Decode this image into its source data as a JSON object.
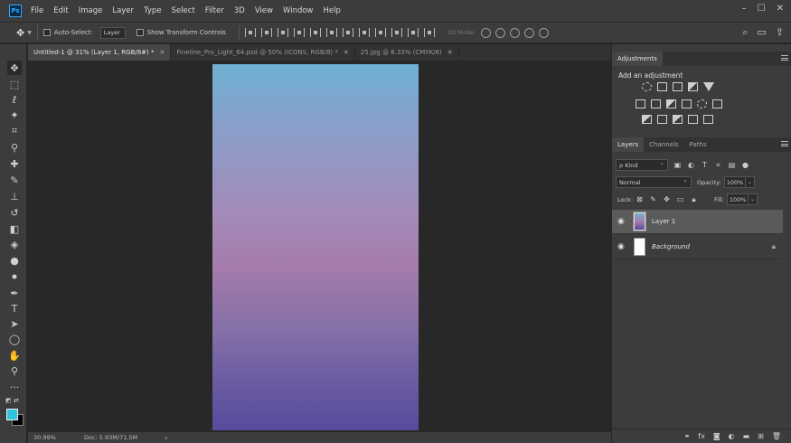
{
  "app": {
    "logo_text": "Ps"
  },
  "menu": [
    "File",
    "Edit",
    "Image",
    "Layer",
    "Type",
    "Select",
    "Filter",
    "3D",
    "View",
    "Window",
    "Help"
  ],
  "options_bar": {
    "auto_select_label": "Auto-Select:",
    "auto_select_value": "Layer",
    "show_transform_label": "Show Transform Controls",
    "three_d_mode_label": "3D Mode:"
  },
  "doc_tabs": [
    {
      "label": "Untitled-1 @ 31% (Layer 1, RGB/8#) *",
      "active": true
    },
    {
      "label": "Fineline_Pro_Light_64.psd @ 50% (ICONS, RGB/8) *",
      "active": false
    },
    {
      "label": "25.jpg @ 8.33% (CMYK/8)",
      "active": false
    }
  ],
  "status": {
    "zoom": "30.99%",
    "doc": "Doc: 5.93M/71.5M",
    "arrow": "›"
  },
  "adjustments": {
    "tab": "Adjustments",
    "title": "Add an adjustment"
  },
  "layers_panel": {
    "tabs": [
      "Layers",
      "Channels",
      "Paths"
    ],
    "kind_label": "ρ Kind",
    "blend_mode": "Normal",
    "opacity_label": "Opacity:",
    "opacity_value": "100%",
    "lock_label": "Lock:",
    "fill_label": "Fill:",
    "fill_value": "100%",
    "layers": [
      {
        "name": "Layer 1",
        "selected": true
      },
      {
        "name": "Background",
        "selected": false
      }
    ]
  },
  "colors": {
    "foreground": "#2ec4e0",
    "background": "#000000"
  }
}
